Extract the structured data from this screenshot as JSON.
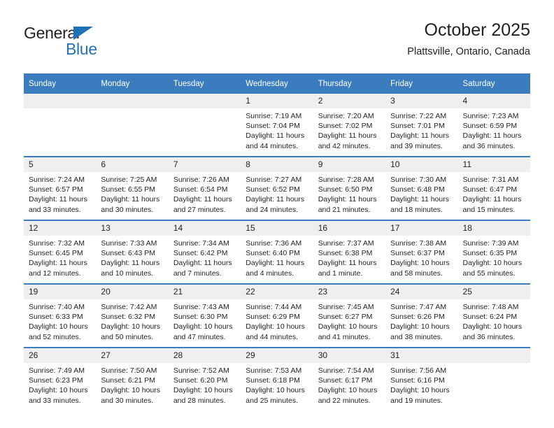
{
  "brand": {
    "name_top": "General",
    "name_bottom": "Blue",
    "triangle_color": "#1f72b8",
    "text_color": "#231f20"
  },
  "header": {
    "title": "October 2025",
    "subtitle": "Plattsville, Ontario, Canada"
  },
  "theme": {
    "header_row_bg": "#3a7cbe",
    "header_row_text": "#ffffff",
    "daynum_bg": "#efefef",
    "cell_bg": "#ffffff",
    "row_divider": "#3a7cbe"
  },
  "weekday_headers": [
    "Sunday",
    "Monday",
    "Tuesday",
    "Wednesday",
    "Thursday",
    "Friday",
    "Saturday"
  ],
  "weeks": [
    [
      {
        "day": "",
        "lines": []
      },
      {
        "day": "",
        "lines": []
      },
      {
        "day": "",
        "lines": []
      },
      {
        "day": "1",
        "lines": [
          "Sunrise: 7:19 AM",
          "Sunset: 7:04 PM",
          "Daylight: 11 hours",
          "and 44 minutes."
        ]
      },
      {
        "day": "2",
        "lines": [
          "Sunrise: 7:20 AM",
          "Sunset: 7:02 PM",
          "Daylight: 11 hours",
          "and 42 minutes."
        ]
      },
      {
        "day": "3",
        "lines": [
          "Sunrise: 7:22 AM",
          "Sunset: 7:01 PM",
          "Daylight: 11 hours",
          "and 39 minutes."
        ]
      },
      {
        "day": "4",
        "lines": [
          "Sunrise: 7:23 AM",
          "Sunset: 6:59 PM",
          "Daylight: 11 hours",
          "and 36 minutes."
        ]
      }
    ],
    [
      {
        "day": "5",
        "lines": [
          "Sunrise: 7:24 AM",
          "Sunset: 6:57 PM",
          "Daylight: 11 hours",
          "and 33 minutes."
        ]
      },
      {
        "day": "6",
        "lines": [
          "Sunrise: 7:25 AM",
          "Sunset: 6:55 PM",
          "Daylight: 11 hours",
          "and 30 minutes."
        ]
      },
      {
        "day": "7",
        "lines": [
          "Sunrise: 7:26 AM",
          "Sunset: 6:54 PM",
          "Daylight: 11 hours",
          "and 27 minutes."
        ]
      },
      {
        "day": "8",
        "lines": [
          "Sunrise: 7:27 AM",
          "Sunset: 6:52 PM",
          "Daylight: 11 hours",
          "and 24 minutes."
        ]
      },
      {
        "day": "9",
        "lines": [
          "Sunrise: 7:28 AM",
          "Sunset: 6:50 PM",
          "Daylight: 11 hours",
          "and 21 minutes."
        ]
      },
      {
        "day": "10",
        "lines": [
          "Sunrise: 7:30 AM",
          "Sunset: 6:48 PM",
          "Daylight: 11 hours",
          "and 18 minutes."
        ]
      },
      {
        "day": "11",
        "lines": [
          "Sunrise: 7:31 AM",
          "Sunset: 6:47 PM",
          "Daylight: 11 hours",
          "and 15 minutes."
        ]
      }
    ],
    [
      {
        "day": "12",
        "lines": [
          "Sunrise: 7:32 AM",
          "Sunset: 6:45 PM",
          "Daylight: 11 hours",
          "and 12 minutes."
        ]
      },
      {
        "day": "13",
        "lines": [
          "Sunrise: 7:33 AM",
          "Sunset: 6:43 PM",
          "Daylight: 11 hours",
          "and 10 minutes."
        ]
      },
      {
        "day": "14",
        "lines": [
          "Sunrise: 7:34 AM",
          "Sunset: 6:42 PM",
          "Daylight: 11 hours",
          "and 7 minutes."
        ]
      },
      {
        "day": "15",
        "lines": [
          "Sunrise: 7:36 AM",
          "Sunset: 6:40 PM",
          "Daylight: 11 hours",
          "and 4 minutes."
        ]
      },
      {
        "day": "16",
        "lines": [
          "Sunrise: 7:37 AM",
          "Sunset: 6:38 PM",
          "Daylight: 11 hours",
          "and 1 minute."
        ]
      },
      {
        "day": "17",
        "lines": [
          "Sunrise: 7:38 AM",
          "Sunset: 6:37 PM",
          "Daylight: 10 hours",
          "and 58 minutes."
        ]
      },
      {
        "day": "18",
        "lines": [
          "Sunrise: 7:39 AM",
          "Sunset: 6:35 PM",
          "Daylight: 10 hours",
          "and 55 minutes."
        ]
      }
    ],
    [
      {
        "day": "19",
        "lines": [
          "Sunrise: 7:40 AM",
          "Sunset: 6:33 PM",
          "Daylight: 10 hours",
          "and 52 minutes."
        ]
      },
      {
        "day": "20",
        "lines": [
          "Sunrise: 7:42 AM",
          "Sunset: 6:32 PM",
          "Daylight: 10 hours",
          "and 50 minutes."
        ]
      },
      {
        "day": "21",
        "lines": [
          "Sunrise: 7:43 AM",
          "Sunset: 6:30 PM",
          "Daylight: 10 hours",
          "and 47 minutes."
        ]
      },
      {
        "day": "22",
        "lines": [
          "Sunrise: 7:44 AM",
          "Sunset: 6:29 PM",
          "Daylight: 10 hours",
          "and 44 minutes."
        ]
      },
      {
        "day": "23",
        "lines": [
          "Sunrise: 7:45 AM",
          "Sunset: 6:27 PM",
          "Daylight: 10 hours",
          "and 41 minutes."
        ]
      },
      {
        "day": "24",
        "lines": [
          "Sunrise: 7:47 AM",
          "Sunset: 6:26 PM",
          "Daylight: 10 hours",
          "and 38 minutes."
        ]
      },
      {
        "day": "25",
        "lines": [
          "Sunrise: 7:48 AM",
          "Sunset: 6:24 PM",
          "Daylight: 10 hours",
          "and 36 minutes."
        ]
      }
    ],
    [
      {
        "day": "26",
        "lines": [
          "Sunrise: 7:49 AM",
          "Sunset: 6:23 PM",
          "Daylight: 10 hours",
          "and 33 minutes."
        ]
      },
      {
        "day": "27",
        "lines": [
          "Sunrise: 7:50 AM",
          "Sunset: 6:21 PM",
          "Daylight: 10 hours",
          "and 30 minutes."
        ]
      },
      {
        "day": "28",
        "lines": [
          "Sunrise: 7:52 AM",
          "Sunset: 6:20 PM",
          "Daylight: 10 hours",
          "and 28 minutes."
        ]
      },
      {
        "day": "29",
        "lines": [
          "Sunrise: 7:53 AM",
          "Sunset: 6:18 PM",
          "Daylight: 10 hours",
          "and 25 minutes."
        ]
      },
      {
        "day": "30",
        "lines": [
          "Sunrise: 7:54 AM",
          "Sunset: 6:17 PM",
          "Daylight: 10 hours",
          "and 22 minutes."
        ]
      },
      {
        "day": "31",
        "lines": [
          "Sunrise: 7:56 AM",
          "Sunset: 6:16 PM",
          "Daylight: 10 hours",
          "and 19 minutes."
        ]
      },
      {
        "day": "",
        "lines": []
      }
    ]
  ]
}
